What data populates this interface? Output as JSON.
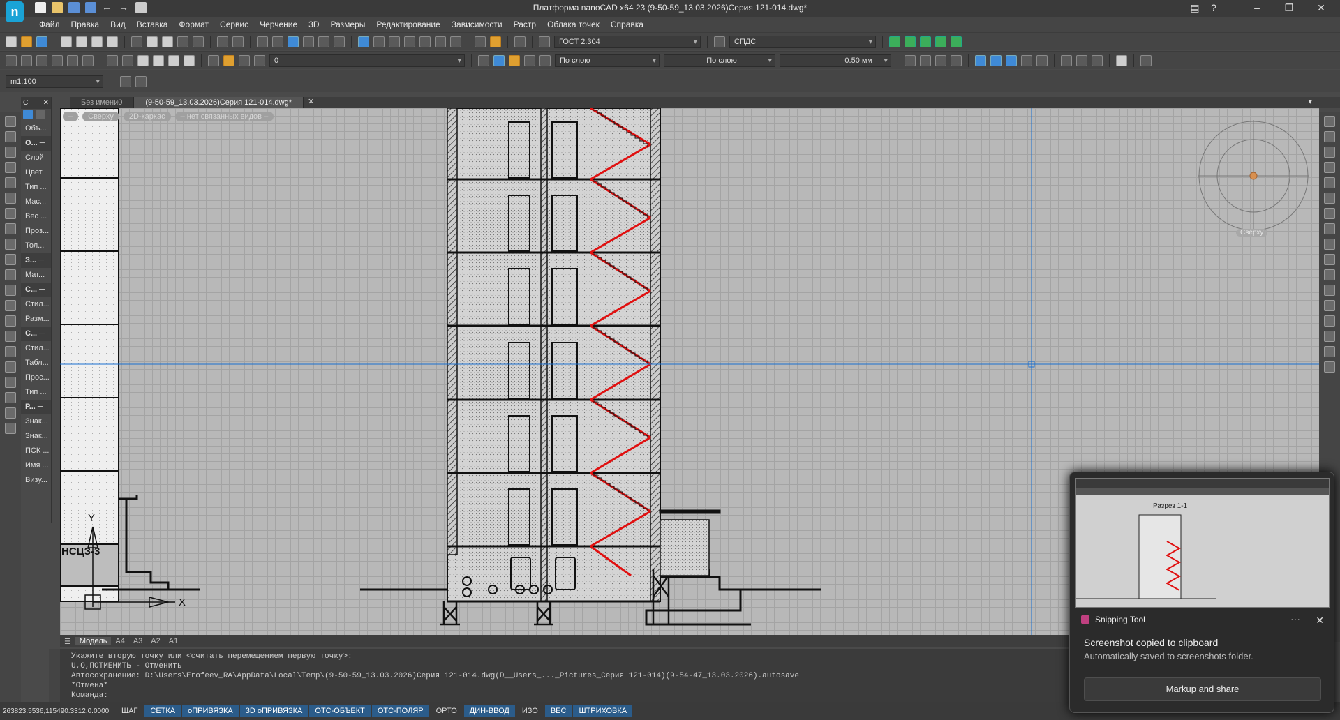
{
  "window": {
    "title": "Платформа nanoCAD x64 23 (9-50-59_13.03.2026)Серия 121-014.dwg*",
    "help": "?"
  },
  "menu": [
    "Файл",
    "Правка",
    "Вид",
    "Вставка",
    "Формат",
    "Сервис",
    "Черчение",
    "3D",
    "Размеры",
    "Редактирование",
    "Зависимости",
    "Растр",
    "Облака точек",
    "Справка"
  ],
  "toolbar": {
    "text_style": "ГОСТ 2.304",
    "dim_style": "СПДС",
    "layer": "0",
    "color": "По слою",
    "linetype": "По слою",
    "lineweight": "0.50 мм",
    "scale": "m1:100"
  },
  "doc_tabs": [
    {
      "label": "Без имени0"
    },
    {
      "label": "(9-50-59_13.03.2026)Серия 121-014.dwg*"
    }
  ],
  "view_labels": [
    "Сверху",
    "2D-каркас",
    "– нет связанных видов –"
  ],
  "props_header": "С",
  "props": [
    {
      "label": "Объ..."
    },
    {
      "label": "О... ─",
      "bold": true
    },
    {
      "label": "Слой"
    },
    {
      "label": "Цвет"
    },
    {
      "label": "Тип ..."
    },
    {
      "label": "Мас..."
    },
    {
      "label": "Вес ..."
    },
    {
      "label": "Проз..."
    },
    {
      "label": "Тол..."
    },
    {
      "label": "З... ─",
      "bold": true
    },
    {
      "label": "Мат..."
    },
    {
      "label": "С... ─",
      "bold": true
    },
    {
      "label": "Стил..."
    },
    {
      "label": "Разм..."
    },
    {
      "label": "С... ─",
      "bold": true
    },
    {
      "label": "Стил..."
    },
    {
      "label": "Табл..."
    },
    {
      "label": "Прос..."
    },
    {
      "label": "Тип ..."
    },
    {
      "label": "Р... ─",
      "bold": true
    },
    {
      "label": "Знак..."
    },
    {
      "label": "Знак..."
    },
    {
      "label": "ПСК ..."
    },
    {
      "label": "Имя ..."
    },
    {
      "label": "Визу..."
    }
  ],
  "drawing": {
    "tag": "НСЦЗ-3",
    "y_axis": "Y",
    "x_axis": "X"
  },
  "viewcube": {
    "label": "Сверху"
  },
  "layout_tabs": [
    "Модель",
    "А4",
    "А3",
    "А2",
    "А1"
  ],
  "command": [
    "Укажите вторую точку или <считать перемещением первую точку>:",
    "U,O,ПОТМЕНИТЬ - Отменить",
    "Автосохранение: D:\\Users\\Erofeev_RA\\AppData\\Local\\Temp\\(9-50-59_13.03.2026)Серия 121-014.dwg(D__Users_..._Pictures_Серия 121-014)(9-54-47_13.03.2026).autosave",
    "*Отмена*",
    "Команда:"
  ],
  "status": {
    "coords": "263823.5536,115490.3312,0.0000",
    "toggles": [
      {
        "label": "ШАГ",
        "on": false
      },
      {
        "label": "СЕТКА",
        "on": true
      },
      {
        "label": "оПРИВЯЗКА",
        "on": true
      },
      {
        "label": "3D оПРИВЯЗКА",
        "on": true
      },
      {
        "label": "ОТС-ОБЪЕКТ",
        "on": true
      },
      {
        "label": "ОТС-ПОЛЯР",
        "on": true
      },
      {
        "label": "ОРТО",
        "on": false
      },
      {
        "label": "ДИН-ВВОД",
        "on": true
      },
      {
        "label": "ИЗО",
        "on": false
      },
      {
        "label": "ВЕС",
        "on": true
      },
      {
        "label": "ШТРИХОВКА",
        "on": true
      }
    ]
  },
  "notification": {
    "app": "Snipping Tool",
    "title": "Screenshot copied to clipboard",
    "body": "Automatically saved to screenshots folder.",
    "button": "Markup and share",
    "thumb_label": "Разрез 1-1"
  },
  "colors": {
    "accent": "#2b5c8a",
    "stair": "#e01010",
    "canvas": "#b8b8b8",
    "crosshair": "#1a6fd0"
  }
}
